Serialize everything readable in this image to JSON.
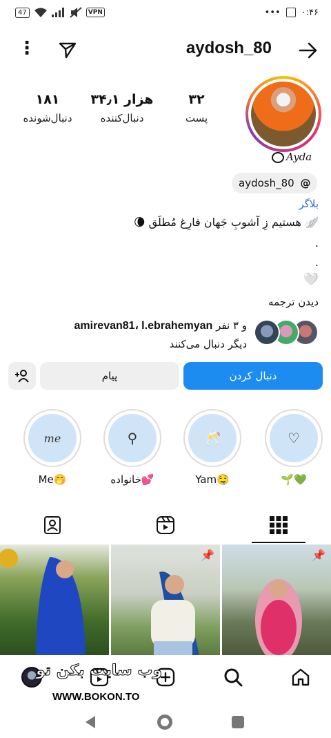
{
  "status_bar": {
    "battery": "47",
    "vpn": "VPN",
    "dots": "•••",
    "time": "۰:۴۶"
  },
  "header": {
    "username": "aydosh_80"
  },
  "stats": [
    {
      "value": "۳۲",
      "label": "پست"
    },
    {
      "value": "۳۴٫۱ هزار",
      "label": "دنبال‌کننده"
    },
    {
      "value": "۱۸۱",
      "label": "دنبال‌شونده"
    }
  ],
  "signature": "Ayda",
  "threads": {
    "handle": "aydosh_80",
    "icon": "@"
  },
  "bio": {
    "category": "بلاگر",
    "line1": "هستیم زِ آشوبِ جَهان فارِغ مُطلَق",
    "moon": "🌘",
    "wing": "🪽",
    "dot1": ".",
    "dot2": ".",
    "heart": "🤍",
    "translate": "دیدن ترجمه"
  },
  "followed_by": {
    "users": "amirevan81، l.ebrahemyan",
    "suffix": "و ۳ نفر",
    "line2": "دیگر دنبال می‌کنند"
  },
  "buttons": {
    "follow": "دنبال کردن",
    "message": "پیام"
  },
  "highlights": [
    {
      "label": "🌱💚",
      "inner": "♡"
    },
    {
      "label": "Yam🤤",
      "inner": "🥂"
    },
    {
      "label": "خانواده💕",
      "inner": "⚲"
    },
    {
      "label": "Me🤭",
      "inner": "me"
    }
  ],
  "watermark": {
    "site_fa": "وب سایت بکن تو",
    "site_en": "WWW.BOKON.TO"
  },
  "colors": {
    "follow_blue": "#1d8cf0",
    "category_blue": "#2f6bd3",
    "highlight_bg": "#cfe5f7"
  }
}
